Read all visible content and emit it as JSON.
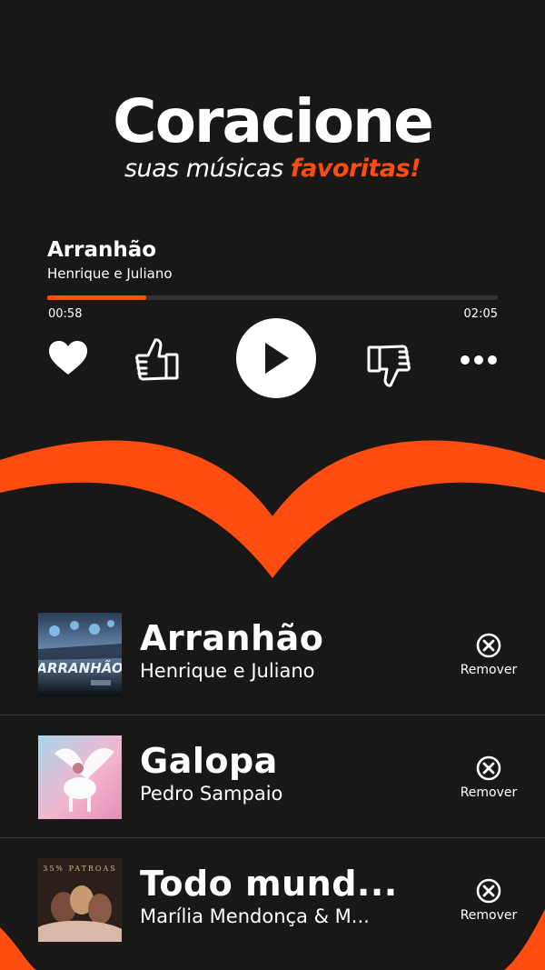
{
  "header": {
    "title": "Coracione",
    "subtitle_prefix": "suas músicas ",
    "subtitle_accent": "favoritas!"
  },
  "player": {
    "song_title": "Arranhão",
    "song_artist": "Henrique e Juliano",
    "time_current": "00:58",
    "time_total": "02:05",
    "progress_fraction": 0.22,
    "icons": [
      "heart-icon",
      "thumbs-up-icon",
      "play-icon",
      "thumbs-down-icon",
      "more-icon"
    ]
  },
  "favorites": [
    {
      "title": "Arranhão",
      "artist": "Henrique e Juliano",
      "cover_text": "ARRANHÃO",
      "remove_label": "Remover"
    },
    {
      "title": "Galopa",
      "artist": "Pedro Sampaio",
      "cover_text": "",
      "remove_label": "Remover"
    },
    {
      "title": "Todo mund...",
      "artist": "Marília Mendonça & M...",
      "cover_text": "35% PATROAS",
      "remove_label": "Remover"
    }
  ],
  "colors": {
    "background": "#1a1816",
    "accent": "#ff4d12",
    "text": "#ffffff"
  }
}
